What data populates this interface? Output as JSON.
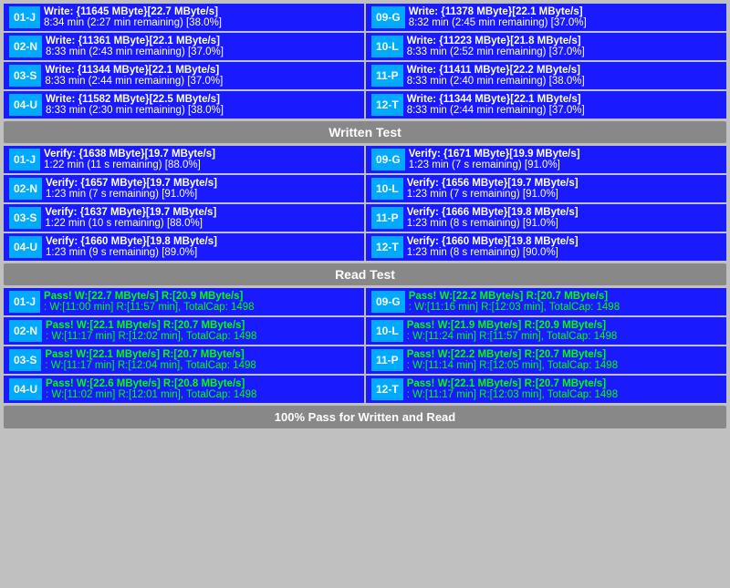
{
  "sections": {
    "write": {
      "rows": [
        {
          "left": {
            "id": "01-J",
            "line1": "Write: {11645 MByte}[22.7 MByte/s]",
            "line2": "8:34 min (2:27 min remaining)  [38.0%]"
          },
          "right": {
            "id": "09-G",
            "line1": "Write: {11378 MByte}[22.1 MByte/s]",
            "line2": "8:32 min (2:45 min remaining)  [37.0%]"
          }
        },
        {
          "left": {
            "id": "02-N",
            "line1": "Write: {11361 MByte}[22.1 MByte/s]",
            "line2": "8:33 min (2:43 min remaining)  [37.0%]"
          },
          "right": {
            "id": "10-L",
            "line1": "Write: {11223 MByte}[21.8 MByte/s]",
            "line2": "8:33 min (2:52 min remaining)  [37.0%]"
          }
        },
        {
          "left": {
            "id": "03-S",
            "line1": "Write: {11344 MByte}[22.1 MByte/s]",
            "line2": "8:33 min (2:44 min remaining)  [37.0%]"
          },
          "right": {
            "id": "11-P",
            "line1": "Write: {11411 MByte}[22.2 MByte/s]",
            "line2": "8:33 min (2:40 min remaining)  [38.0%]"
          }
        },
        {
          "left": {
            "id": "04-U",
            "line1": "Write: {11582 MByte}[22.5 MByte/s]",
            "line2": "8:33 min (2:30 min remaining)  [38.0%]"
          },
          "right": {
            "id": "12-T",
            "line1": "Write: {11344 MByte}[22.1 MByte/s]",
            "line2": "8:33 min (2:44 min remaining)  [37.0%]"
          }
        }
      ],
      "header": "Written Test"
    },
    "verify": {
      "rows": [
        {
          "left": {
            "id": "01-J",
            "line1": "Verify: {1638 MByte}[19.7 MByte/s]",
            "line2": "1:22 min (11 s remaining)   [88.0%]"
          },
          "right": {
            "id": "09-G",
            "line1": "Verify: {1671 MByte}[19.9 MByte/s]",
            "line2": "1:23 min (7 s remaining)   [91.0%]"
          }
        },
        {
          "left": {
            "id": "02-N",
            "line1": "Verify: {1657 MByte}[19.7 MByte/s]",
            "line2": "1:23 min (7 s remaining)   [91.0%]"
          },
          "right": {
            "id": "10-L",
            "line1": "Verify: {1656 MByte}[19.7 MByte/s]",
            "line2": "1:23 min (7 s remaining)   [91.0%]"
          }
        },
        {
          "left": {
            "id": "03-S",
            "line1": "Verify: {1637 MByte}[19.7 MByte/s]",
            "line2": "1:22 min (10 s remaining)   [88.0%]"
          },
          "right": {
            "id": "11-P",
            "line1": "Verify: {1666 MByte}[19.8 MByte/s]",
            "line2": "1:23 min (8 s remaining)   [91.0%]"
          }
        },
        {
          "left": {
            "id": "04-U",
            "line1": "Verify: {1660 MByte}[19.8 MByte/s]",
            "line2": "1:23 min (9 s remaining)   [89.0%]"
          },
          "right": {
            "id": "12-T",
            "line1": "Verify: {1660 MByte}[19.8 MByte/s]",
            "line2": "1:23 min (8 s remaining)   [90.0%]"
          }
        }
      ],
      "header": "Read Test"
    },
    "read": {
      "rows": [
        {
          "left": {
            "id": "01-J",
            "line1": "Pass! W:[22.7 MByte/s] R:[20.9 MByte/s]",
            "line2": ": W:[11:00 min] R:[11:57 min], TotalCap: 1498"
          },
          "right": {
            "id": "09-G",
            "line1": "Pass! W:[22.2 MByte/s] R:[20.7 MByte/s]",
            "line2": ": W:[11:16 min] R:[12:03 min], TotalCap: 1498"
          }
        },
        {
          "left": {
            "id": "02-N",
            "line1": "Pass! W:[22.1 MByte/s] R:[20.7 MByte/s]",
            "line2": ": W:[11:17 min] R:[12:02 min], TotalCap: 1498"
          },
          "right": {
            "id": "10-L",
            "line1": "Pass! W:[21.9 MByte/s] R:[20.9 MByte/s]",
            "line2": ": W:[11:24 min] R:[11:57 min], TotalCap: 1498"
          }
        },
        {
          "left": {
            "id": "03-S",
            "line1": "Pass! W:[22.1 MByte/s] R:[20.7 MByte/s]",
            "line2": ": W:[11:17 min] R:[12:04 min], TotalCap: 1498"
          },
          "right": {
            "id": "11-P",
            "line1": "Pass! W:[22.2 MByte/s] R:[20.7 MByte/s]",
            "line2": ": W:[11:14 min] R:[12:05 min], TotalCap: 1498"
          }
        },
        {
          "left": {
            "id": "04-U",
            "line1": "Pass! W:[22.6 MByte/s] R:[20.8 MByte/s]",
            "line2": ": W:[11:02 min] R:[12:01 min], TotalCap: 1498"
          },
          "right": {
            "id": "12-T",
            "line1": "Pass! W:[22.1 MByte/s] R:[20.7 MByte/s]",
            "line2": ": W:[11:17 min] R:[12:03 min], TotalCap: 1498"
          }
        }
      ]
    },
    "footer": "100% Pass for Written and Read"
  }
}
